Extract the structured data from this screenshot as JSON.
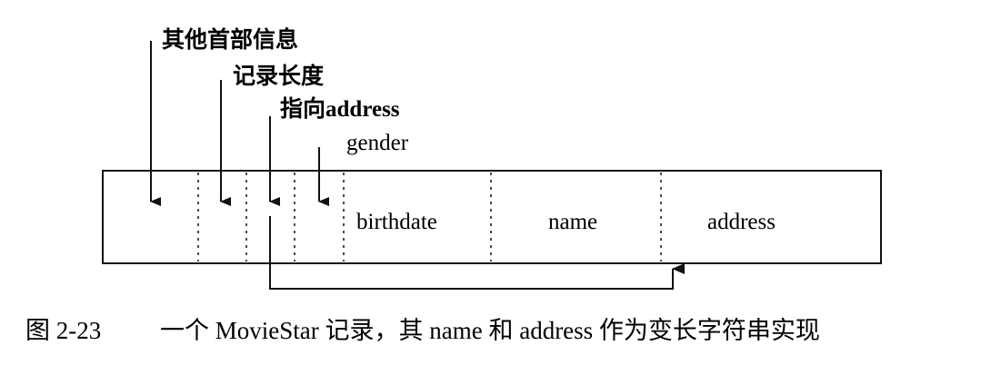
{
  "labels": {
    "other_header": "其他首部信息",
    "record_length": "记录长度",
    "pointer_prefix": "指向",
    "pointer_target": "address",
    "gender": "gender"
  },
  "fields": {
    "birthdate": "birthdate",
    "name": "name",
    "address": "address"
  },
  "caption": {
    "figure_number": "图 2-23",
    "text": "一个 MovieStar 记录，其 name 和 address 作为变长字符串实现"
  }
}
